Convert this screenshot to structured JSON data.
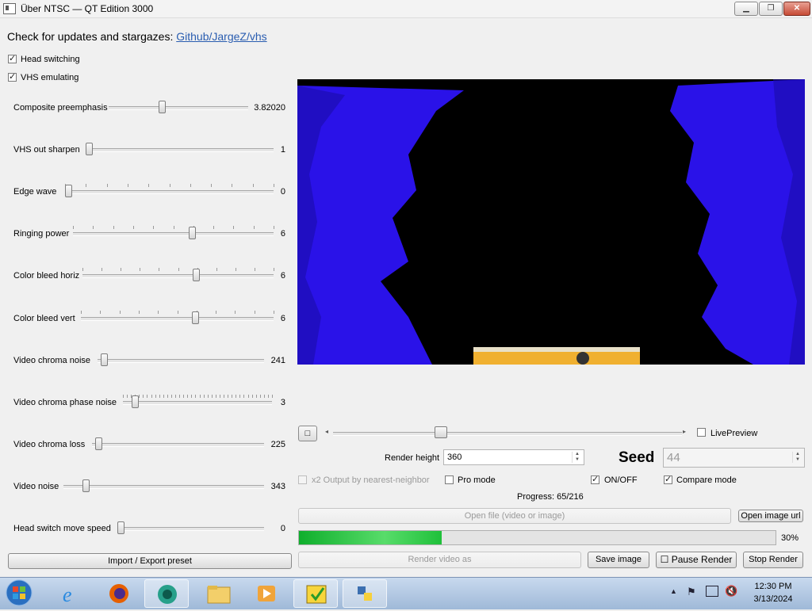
{
  "window": {
    "title": "Über NTSC — QT Edition 3000",
    "min": "▁",
    "max": "❐",
    "close": "✕"
  },
  "update": {
    "text": "Check for updates and stargazes: ",
    "link": "Github/JargeZ/vhs"
  },
  "checkboxes": {
    "head_switching": {
      "label": "Head switching",
      "checked": true
    },
    "vhs_emulating": {
      "label": "VHS emulating",
      "checked": true
    }
  },
  "sliders": [
    {
      "label": "Composite preemphasis",
      "value": "3.82020",
      "position": 0.38
    },
    {
      "label": "VHS out sharpen",
      "value": "1",
      "position": 0.0
    },
    {
      "label": "Edge wave",
      "value": "0",
      "position": 0.0
    },
    {
      "label": "Ringing power",
      "value": "6",
      "position": 0.6
    },
    {
      "label": "Color bleed horiz",
      "value": "6",
      "position": 0.6
    },
    {
      "label": "Color bleed vert",
      "value": "6",
      "position": 0.6
    },
    {
      "label": "Video chroma noise",
      "value": "241",
      "position": 0.02
    },
    {
      "label": "Video chroma phase noise",
      "value": "3",
      "position": 0.06
    },
    {
      "label": "Video chroma loss",
      "value": "225",
      "position": 0.02
    },
    {
      "label": "Video noise",
      "value": "343",
      "position": 0.1
    },
    {
      "label": "Head switch move speed",
      "value": "0",
      "position": 0.0
    }
  ],
  "import_export": "Import / Export preset",
  "timeline": {
    "position": 0.3
  },
  "live_preview": {
    "label": "LivePreview",
    "checked": false
  },
  "render_height": {
    "label": "Render height",
    "value": "360"
  },
  "seed": {
    "label": "Seed",
    "value": "44"
  },
  "options": {
    "x2": {
      "label": "x2 Output by nearest-neighbor",
      "checked": false
    },
    "pro": {
      "label": "Pro mode",
      "checked": false
    },
    "onoff": {
      "label": "ON/OFF",
      "checked": true
    },
    "compare": {
      "label": "Compare mode",
      "checked": true
    }
  },
  "progress_text": "Progress: 65/216",
  "open_file": "Open file (video or image)",
  "open_image_url": "Open image url",
  "render_progress": {
    "percent": 30,
    "label": "30%"
  },
  "render_video": "Render video as",
  "save_image": "Save image",
  "pause_render": "Pause Render",
  "stop_render": "Stop Render",
  "colors": {
    "preview_blue": "#2a12e8",
    "progress_green": "#1fc03a",
    "link": "#2a5db0"
  },
  "taskbar": {
    "apps": [
      "windows-start",
      "internet-explorer",
      "firefox",
      "media-app",
      "file-explorer",
      "media-player",
      "ntsc-app",
      "python-app"
    ],
    "time": "12:30 PM",
    "date": "3/13/2024"
  }
}
